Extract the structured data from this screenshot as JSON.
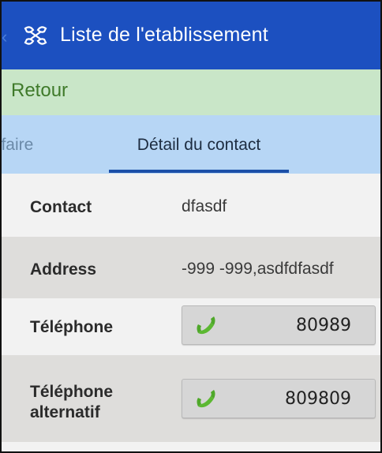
{
  "header": {
    "title": "Liste de l'etablissement",
    "back_glyph": "‹",
    "logo_icon": "app-logo-icon"
  },
  "retour": {
    "label": "Retour"
  },
  "tabs": {
    "items": [
      {
        "label": "ffaire",
        "active": false
      },
      {
        "label": "Détail du contact",
        "active": true
      }
    ]
  },
  "details": {
    "contact": {
      "label": "Contact",
      "value": "dfasdf"
    },
    "address": {
      "label": "Address",
      "value": "-999 -999,asdfdfasdf"
    },
    "telephone": {
      "label": "Téléphone",
      "value": "80989",
      "icon": "phone-icon"
    },
    "telephone_alt": {
      "label_line1": "Téléphone",
      "label_line2": "alternatif",
      "value": "809809",
      "icon": "phone-icon"
    }
  },
  "colors": {
    "appbar": "#1c50c0",
    "retour_bg": "#c9e6c8",
    "retour_text": "#3f7a2a",
    "tabs_bg": "#b7d6f5",
    "tab_indicator": "#1b4fa8",
    "row_light": "#f2f2f2",
    "row_dark": "#dedddb",
    "phone_green": "#4fa82a"
  }
}
